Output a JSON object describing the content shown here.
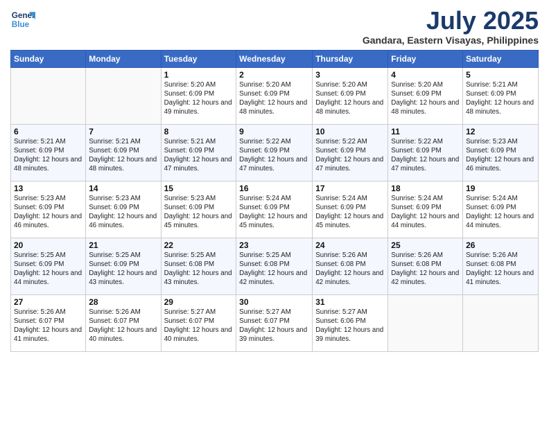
{
  "header": {
    "title": "July 2025",
    "subtitle": "Gandara, Eastern Visayas, Philippines",
    "logo_line1": "General",
    "logo_line2": "Blue"
  },
  "calendar": {
    "days": [
      "Sunday",
      "Monday",
      "Tuesday",
      "Wednesday",
      "Thursday",
      "Friday",
      "Saturday"
    ],
    "weeks": [
      [
        {
          "day": "",
          "info": ""
        },
        {
          "day": "",
          "info": ""
        },
        {
          "day": "1",
          "info": "Sunrise: 5:20 AM\nSunset: 6:09 PM\nDaylight: 12 hours and 49 minutes."
        },
        {
          "day": "2",
          "info": "Sunrise: 5:20 AM\nSunset: 6:09 PM\nDaylight: 12 hours and 48 minutes."
        },
        {
          "day": "3",
          "info": "Sunrise: 5:20 AM\nSunset: 6:09 PM\nDaylight: 12 hours and 48 minutes."
        },
        {
          "day": "4",
          "info": "Sunrise: 5:20 AM\nSunset: 6:09 PM\nDaylight: 12 hours and 48 minutes."
        },
        {
          "day": "5",
          "info": "Sunrise: 5:21 AM\nSunset: 6:09 PM\nDaylight: 12 hours and 48 minutes."
        }
      ],
      [
        {
          "day": "6",
          "info": "Sunrise: 5:21 AM\nSunset: 6:09 PM\nDaylight: 12 hours and 48 minutes."
        },
        {
          "day": "7",
          "info": "Sunrise: 5:21 AM\nSunset: 6:09 PM\nDaylight: 12 hours and 48 minutes."
        },
        {
          "day": "8",
          "info": "Sunrise: 5:21 AM\nSunset: 6:09 PM\nDaylight: 12 hours and 47 minutes."
        },
        {
          "day": "9",
          "info": "Sunrise: 5:22 AM\nSunset: 6:09 PM\nDaylight: 12 hours and 47 minutes."
        },
        {
          "day": "10",
          "info": "Sunrise: 5:22 AM\nSunset: 6:09 PM\nDaylight: 12 hours and 47 minutes."
        },
        {
          "day": "11",
          "info": "Sunrise: 5:22 AM\nSunset: 6:09 PM\nDaylight: 12 hours and 47 minutes."
        },
        {
          "day": "12",
          "info": "Sunrise: 5:23 AM\nSunset: 6:09 PM\nDaylight: 12 hours and 46 minutes."
        }
      ],
      [
        {
          "day": "13",
          "info": "Sunrise: 5:23 AM\nSunset: 6:09 PM\nDaylight: 12 hours and 46 minutes."
        },
        {
          "day": "14",
          "info": "Sunrise: 5:23 AM\nSunset: 6:09 PM\nDaylight: 12 hours and 46 minutes."
        },
        {
          "day": "15",
          "info": "Sunrise: 5:23 AM\nSunset: 6:09 PM\nDaylight: 12 hours and 45 minutes."
        },
        {
          "day": "16",
          "info": "Sunrise: 5:24 AM\nSunset: 6:09 PM\nDaylight: 12 hours and 45 minutes."
        },
        {
          "day": "17",
          "info": "Sunrise: 5:24 AM\nSunset: 6:09 PM\nDaylight: 12 hours and 45 minutes."
        },
        {
          "day": "18",
          "info": "Sunrise: 5:24 AM\nSunset: 6:09 PM\nDaylight: 12 hours and 44 minutes."
        },
        {
          "day": "19",
          "info": "Sunrise: 5:24 AM\nSunset: 6:09 PM\nDaylight: 12 hours and 44 minutes."
        }
      ],
      [
        {
          "day": "20",
          "info": "Sunrise: 5:25 AM\nSunset: 6:09 PM\nDaylight: 12 hours and 44 minutes."
        },
        {
          "day": "21",
          "info": "Sunrise: 5:25 AM\nSunset: 6:09 PM\nDaylight: 12 hours and 43 minutes."
        },
        {
          "day": "22",
          "info": "Sunrise: 5:25 AM\nSunset: 6:08 PM\nDaylight: 12 hours and 43 minutes."
        },
        {
          "day": "23",
          "info": "Sunrise: 5:25 AM\nSunset: 6:08 PM\nDaylight: 12 hours and 42 minutes."
        },
        {
          "day": "24",
          "info": "Sunrise: 5:26 AM\nSunset: 6:08 PM\nDaylight: 12 hours and 42 minutes."
        },
        {
          "day": "25",
          "info": "Sunrise: 5:26 AM\nSunset: 6:08 PM\nDaylight: 12 hours and 42 minutes."
        },
        {
          "day": "26",
          "info": "Sunrise: 5:26 AM\nSunset: 6:08 PM\nDaylight: 12 hours and 41 minutes."
        }
      ],
      [
        {
          "day": "27",
          "info": "Sunrise: 5:26 AM\nSunset: 6:07 PM\nDaylight: 12 hours and 41 minutes."
        },
        {
          "day": "28",
          "info": "Sunrise: 5:26 AM\nSunset: 6:07 PM\nDaylight: 12 hours and 40 minutes."
        },
        {
          "day": "29",
          "info": "Sunrise: 5:27 AM\nSunset: 6:07 PM\nDaylight: 12 hours and 40 minutes."
        },
        {
          "day": "30",
          "info": "Sunrise: 5:27 AM\nSunset: 6:07 PM\nDaylight: 12 hours and 39 minutes."
        },
        {
          "day": "31",
          "info": "Sunrise: 5:27 AM\nSunset: 6:06 PM\nDaylight: 12 hours and 39 minutes."
        },
        {
          "day": "",
          "info": ""
        },
        {
          "day": "",
          "info": ""
        }
      ]
    ]
  }
}
